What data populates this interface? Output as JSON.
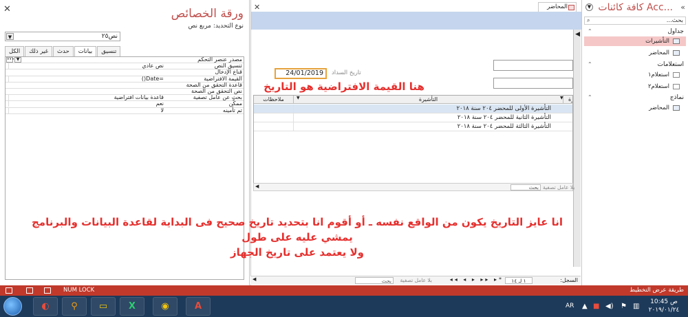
{
  "property_sheet": {
    "title": "ورقة الخصائص",
    "selection_type": "نوع التحديد:  مربع نص",
    "selected_control": "نص٢٥",
    "tabs": [
      "تنسيق",
      "بيانات",
      "حدث",
      "غير ذلك",
      "الكل"
    ],
    "active_tab": "بيانات",
    "rows": [
      {
        "label": "مصدر عنصر التحكم",
        "value": ""
      },
      {
        "label": "تنسيق النص",
        "value": "نص عادي"
      },
      {
        "label": "قناع الإدخال",
        "value": ""
      },
      {
        "label": "القيمة الافتراضية",
        "value": "=Date()"
      },
      {
        "label": "قاعدة التحقق من الصحة",
        "value": ""
      },
      {
        "label": "نص التحقق من الصحة",
        "value": ""
      },
      {
        "label": "بحث عن عامل تصفية",
        "value": "قاعدة بيانات افتراضية"
      },
      {
        "label": "ممكّن",
        "value": "نعم"
      },
      {
        "label": "تم تأمينه",
        "value": "لا"
      }
    ]
  },
  "form": {
    "tab_label": "المحاضر",
    "date_label": "تاريخ السداد",
    "date_value": "24/01/2019",
    "annotation_top": "هنا القيمة الافتراضية هو التاريخ",
    "datasheet": {
      "col_notes": "ملاحظات",
      "col_visa": "التأشيرة",
      "col_first": "رة",
      "rows": [
        "التأشيرة الأولى للمحضر ٢٠٤ سنة ٢٠١٨",
        "التأشيرة الثانية للمحضر ٢٠٤ سنة ٢٠١٨",
        "التأشيرة الثالثة للمحضر ٢٠٤ سنة ٢٠١٨"
      ],
      "search": "بحث",
      "filter": "بلا عامل تصفية"
    },
    "annotation_bottom_1": "انا عايز التاريخ يكون من الواقع نفسه ـ أو أقوم انا بتحديد تاريخ صحيح فى البداية لقاعدة البيانات والبرنامج يمشي عليه على طول",
    "annotation_bottom_2": "ولا يعتمد على تاريخ الجهاز"
  },
  "record_nav": {
    "label": "السجل:",
    "position": "١ لـ ١٤",
    "filter": "بلا عامل تصفية",
    "search": "بحث"
  },
  "nav_pane": {
    "title": "كافة كائنات Acc...",
    "search": "بحث...",
    "groups": [
      {
        "label": "جداول",
        "items": [
          "التأشيرات",
          "المحاضر"
        ]
      },
      {
        "label": "استعلامات",
        "items": [
          "استعلام١",
          "استعلام٢"
        ]
      },
      {
        "label": "نماذج",
        "items": [
          "المحاضر"
        ]
      }
    ]
  },
  "status_bar": {
    "view_label": "طريقة عرض التخطيط",
    "numlock": "NUM LOCK"
  },
  "taskbar": {
    "lang": "AR",
    "time": "10:45 ص",
    "date": "٢٠١٩/٠١/٢٤"
  },
  "colors": {
    "accent": "#c0504d",
    "annotation": "#e5302e",
    "status_bar": "#c0392b",
    "form_band": "#c5d5ed"
  }
}
